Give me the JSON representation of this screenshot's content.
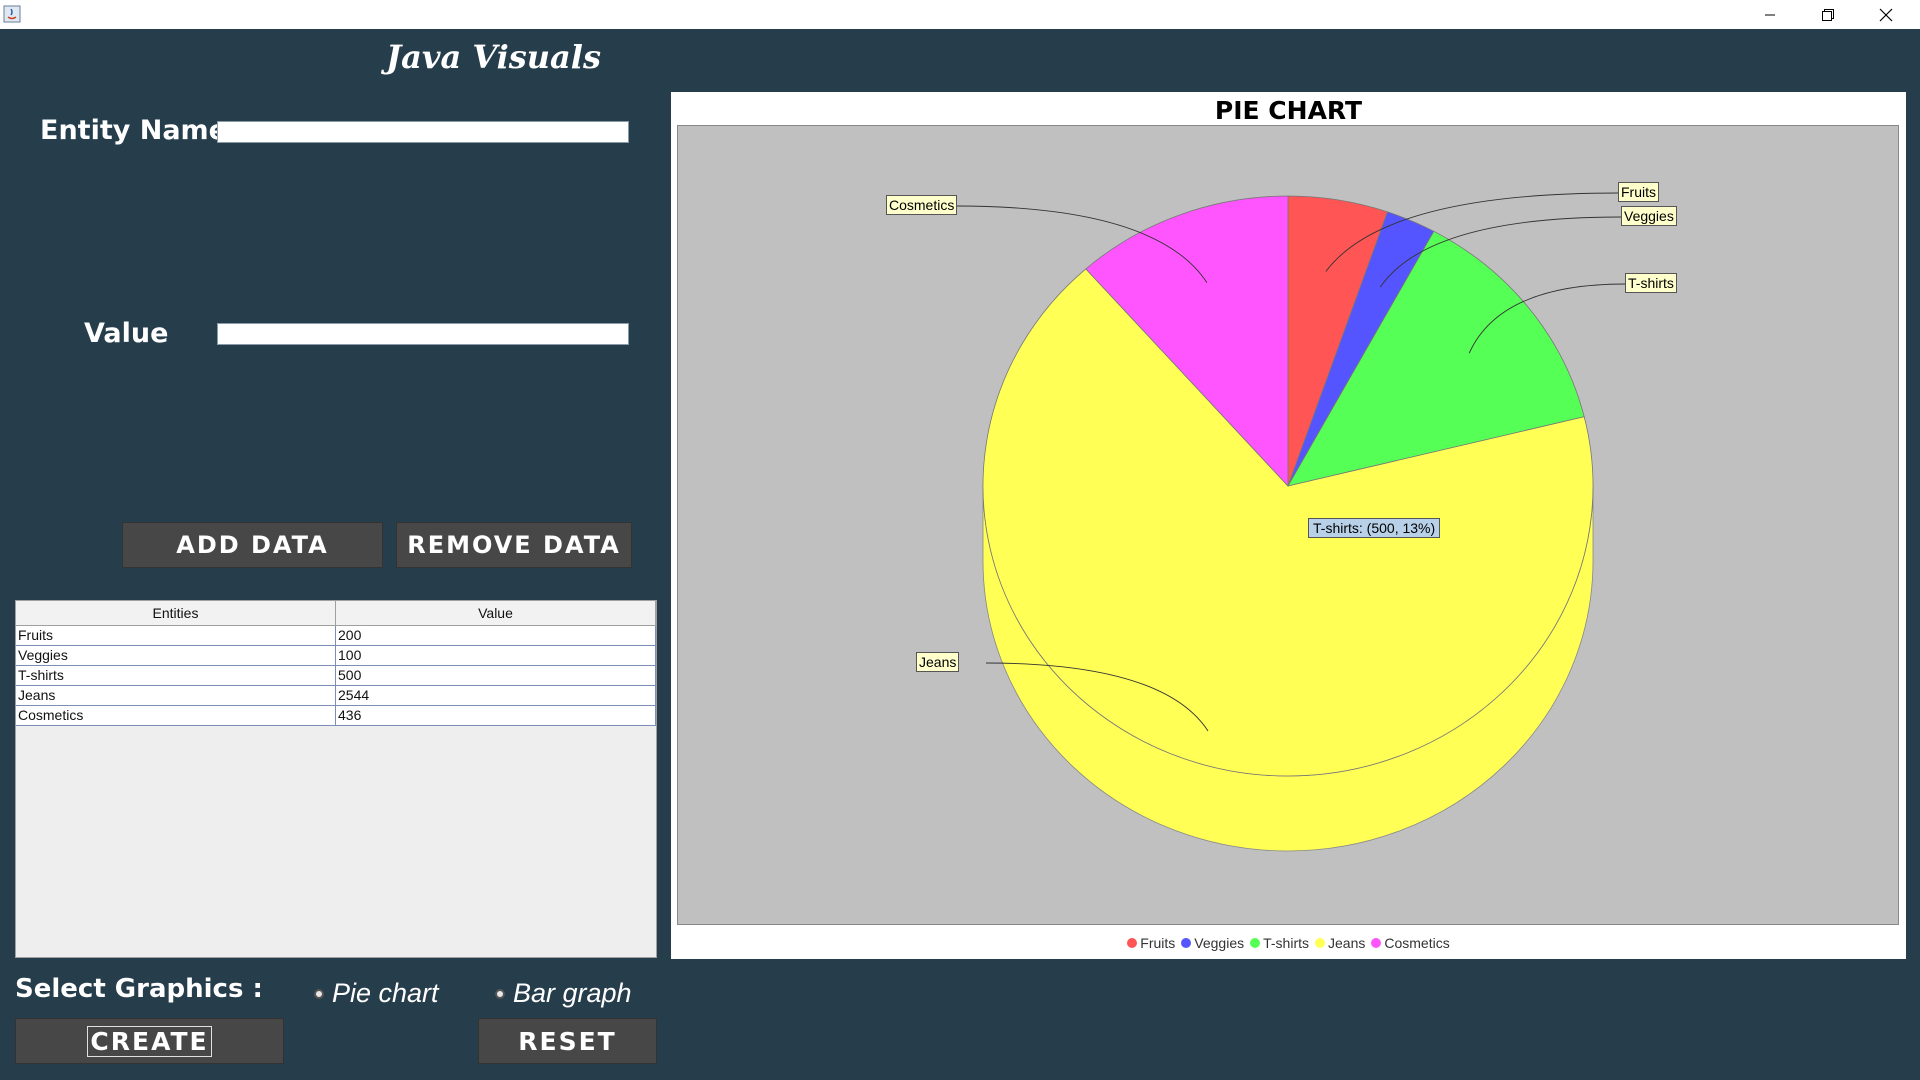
{
  "window": {
    "icon": "java-icon"
  },
  "app_title": "Java Visuals",
  "form": {
    "entity_label": "Entity Name",
    "entity_value": "",
    "value_label": "Value",
    "value_value": ""
  },
  "buttons": {
    "add": "ADD DATA",
    "remove": "REMOVE DATA",
    "create": "CREATE",
    "reset": "RESET"
  },
  "table": {
    "headers": [
      "Entities",
      "Value"
    ],
    "rows": [
      [
        "Fruits",
        "200"
      ],
      [
        "Veggies",
        "100"
      ],
      [
        "T-shirts",
        "500"
      ],
      [
        "Jeans",
        "2544"
      ],
      [
        "Cosmetics",
        "436"
      ]
    ]
  },
  "select": {
    "label": "Select Graphics :",
    "options": [
      "Pie chart",
      "Bar graph"
    ]
  },
  "chart_data": {
    "type": "pie",
    "title": "PIE CHART",
    "categories": [
      "Fruits",
      "Veggies",
      "T-shirts",
      "Jeans",
      "Cosmetics"
    ],
    "values": [
      200,
      100,
      500,
      2544,
      436
    ],
    "colors": [
      "#ff5555",
      "#5555ff",
      "#55ff55",
      "#ffff55",
      "#ff55ff"
    ],
    "tooltip": "T-shirts: (500, 13%)",
    "legend_position": "bottom",
    "background": "#c0c0c0",
    "style": "3d"
  }
}
